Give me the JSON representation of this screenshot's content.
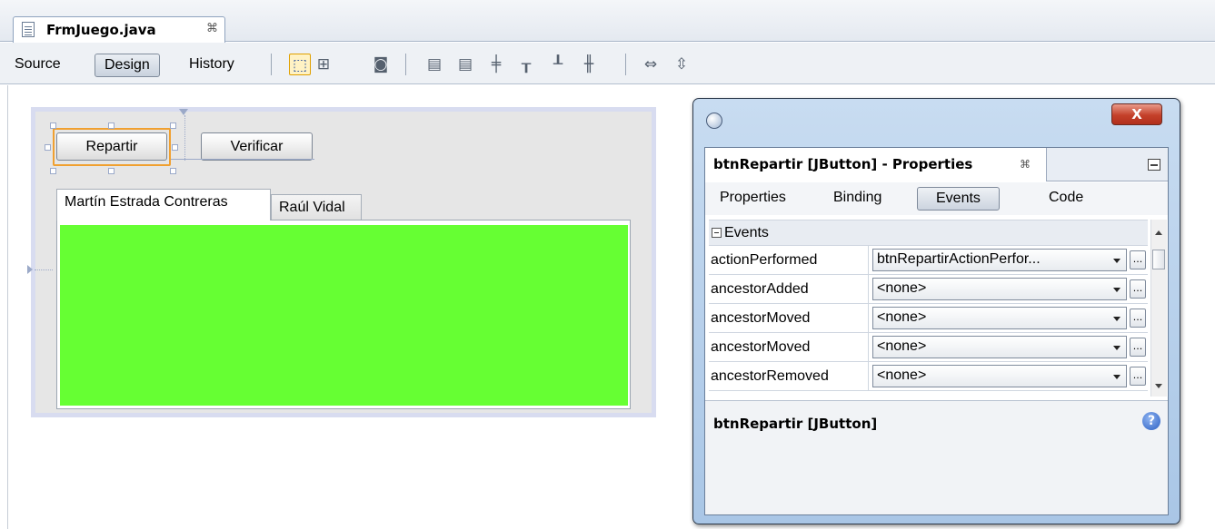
{
  "editor": {
    "file_tab": {
      "label": "FrmJuego.java",
      "close_glyph": "⌘"
    }
  },
  "toolbar": {
    "source_label": "Source",
    "design_label": "Design",
    "history_label": "History",
    "active_view": "Design",
    "icons": [
      "selection-mode-icon",
      "connection-mode-icon",
      "preview-design-icon",
      "align-left-icon",
      "align-right-icon",
      "center-horizontally-icon",
      "align-top-icon",
      "align-bottom-icon",
      "center-vertically-icon",
      "change-horizontal-resizability-icon",
      "change-vertical-resizability-icon"
    ]
  },
  "form": {
    "buttons": {
      "repartir": "Repartir",
      "verificar": "Verificar"
    },
    "tabs": [
      "Martín Estrada Contreras",
      "Raúl Vidal"
    ],
    "active_tab": "Martín Estrada Contreras",
    "panel_color": "#66ff33",
    "selected_component": "Repartir"
  },
  "properties_window": {
    "tab_title": "btnRepartir [JButton] - Properties",
    "tab_close_glyph": "⌘",
    "close_glyph": "X",
    "subtabs": [
      "Properties",
      "Binding",
      "Events",
      "Code"
    ],
    "active_subtab": "Events",
    "group_label": "Events",
    "rows": [
      {
        "name": "actionPerformed",
        "value": "btnRepartirActionPerfor..."
      },
      {
        "name": "ancestorAdded",
        "value": "<none>"
      },
      {
        "name": "ancestorMoved",
        "value": "<none>"
      },
      {
        "name": "ancestorMoved",
        "value": "<none>"
      },
      {
        "name": "ancestorRemoved",
        "value": "<none>"
      }
    ],
    "ellipsis_label": "...",
    "description_title": "btnRepartir [JButton]",
    "help_glyph": "?",
    "colors": {
      "title_gradient": "#b9d1ec",
      "close_button": "#c4402a"
    }
  }
}
